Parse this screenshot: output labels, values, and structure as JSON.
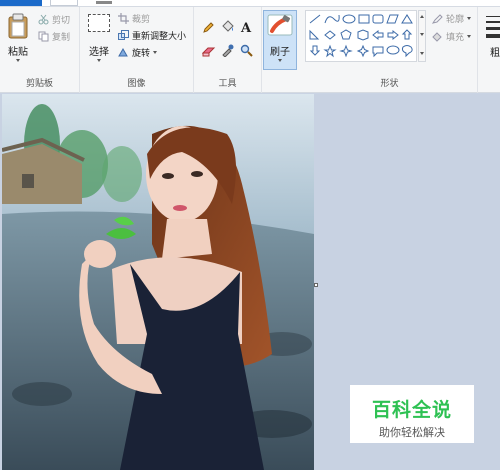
{
  "clipboard": {
    "paste_label": "粘贴",
    "cut_label": "剪切",
    "copy_label": "复制",
    "group_label": "剪贴板"
  },
  "image": {
    "select_label": "选择",
    "crop_label": "裁剪",
    "resize_label": "重新调整大小",
    "rotate_label": "旋转",
    "group_label": "图像"
  },
  "tools": {
    "group_label": "工具",
    "items": [
      "pencil-icon",
      "fill-bucket-icon",
      "text-icon",
      "eraser-icon",
      "color-picker-icon",
      "magnifier-icon"
    ]
  },
  "brushes": {
    "label": "刷子"
  },
  "shapes": {
    "group_label": "形状",
    "outline_label": "轮廓",
    "fill_label": "填充"
  },
  "size": {
    "label_partial": "粗"
  },
  "watermark": {
    "title": "百科全说",
    "subtitle": "助你轻松解决"
  },
  "colors": {
    "accent": "#1b6ac9",
    "watermark_green": "#2ec153",
    "canvas_bg": "#c8d2e2"
  }
}
